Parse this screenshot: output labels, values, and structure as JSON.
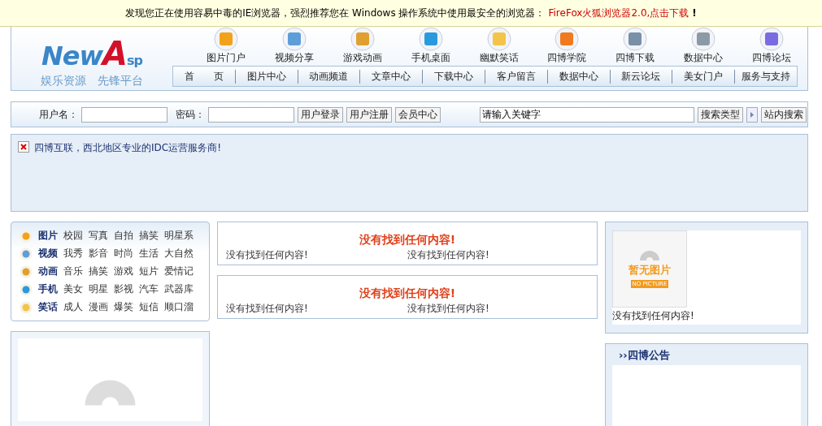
{
  "notice_bar": {
    "text": "发现您正在使用容易中毒的IE浏览器，强烈推荐您在 Windows 操作系统中使用最安全的浏览器：",
    "link": "FireFox火狐浏览器2.0,点击下载",
    "mark": "!"
  },
  "logo": {
    "word_1": "New",
    "letter": "A",
    "word_2": "sp",
    "slogan": "娱乐资源　先锋平台"
  },
  "icon_nav": [
    "图片门户",
    "视频分享",
    "游戏动画",
    "手机桌面",
    "幽默笑话",
    "四博学院",
    "四博下载",
    "数据中心",
    "四博论坛"
  ],
  "menu": [
    "首　　页",
    "图片中心",
    "动画频道",
    "文章中心",
    "下载中心",
    "客户留言",
    "数据中心",
    "新云论坛",
    "美女门户",
    "服务与支持"
  ],
  "login": {
    "username_label": "用户名：",
    "password_label": "密码：",
    "buttons": [
      "用户登录",
      "用户注册",
      "会员中心"
    ]
  },
  "search": {
    "value": "请输入关键字",
    "type_button": "搜索类型",
    "submit": "站内搜索"
  },
  "announcement": {
    "text": "四博互联，西北地区专业的IDC运营服务商!"
  },
  "categories": [
    {
      "title": "图片",
      "links": [
        "校园",
        "写真",
        "自拍",
        "搞笑",
        "明星系"
      ]
    },
    {
      "title": "视频",
      "links": [
        "我秀",
        "影音",
        "时尚",
        "生活",
        "大自然"
      ]
    },
    {
      "title": "动画",
      "links": [
        "音乐",
        "搞笑",
        "游戏",
        "短片",
        "爱情记"
      ]
    },
    {
      "title": "手机",
      "links": [
        "美女",
        "明星",
        "影视",
        "汽车",
        "武器库"
      ]
    },
    {
      "title": "笑话",
      "links": [
        "成人",
        "漫画",
        "爆笑",
        "短信",
        "顺口溜"
      ]
    }
  ],
  "content_boxes": [
    {
      "heading": "没有找到任何内容!",
      "items": [
        "没有找到任何内容!",
        "没有找到任何内容!"
      ]
    },
    {
      "heading": "没有找到任何内容!",
      "items": [
        "没有找到任何内容!",
        "没有找到任何内容!"
      ]
    }
  ],
  "photo_box": {
    "badge_title": "暂无图片",
    "badge_caption": "NO PICTURE",
    "caption": "没有找到任何内容!"
  },
  "notice_panel": {
    "title": "››四博公告"
  }
}
